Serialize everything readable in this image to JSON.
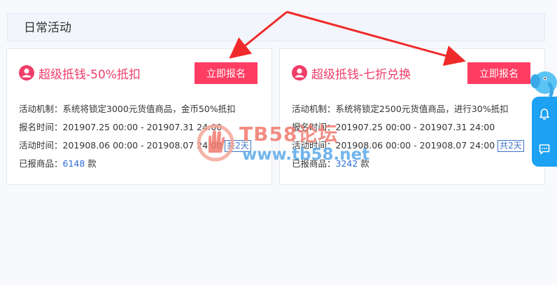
{
  "section": {
    "title": "日常活动"
  },
  "cards": [
    {
      "title": "超级抵钱-50%抵扣",
      "button": "立即报名",
      "mechanism_label": "活动机制：",
      "mechanism": "系统将锁定3000元货值商品，金币50%抵扣",
      "signup_label": "报名时间：",
      "signup_time": "201907.25 00:00 - 201907.31 24:00",
      "activity_label": "活动时间：",
      "activity_time": "201908.06 00:00 - 201908.07 24:00",
      "duration": "共2天",
      "reported_label": "已报商品：",
      "reported_count": "6148",
      "reported_unit": " 款"
    },
    {
      "title": "超级抵钱-七折兑换",
      "button": "立即报名",
      "mechanism_label": "活动机制：",
      "mechanism": "系统将锁定2500元货值商品，进行30%抵扣",
      "signup_label": "报名时间：",
      "signup_time": "201907.25 00:00 - 201907.31 24:00",
      "activity_label": "活动时间：",
      "activity_time": "201908.06 00:00 - 201908.07 24:00",
      "duration": "共2天",
      "reported_label": "已报商品：",
      "reported_count": "3242",
      "reported_unit": " 款"
    }
  ],
  "watermark": {
    "title": "TB58论坛",
    "url": "www.tb58.net"
  },
  "colors": {
    "accent": "#ff3d63",
    "title": "#f03d6a",
    "link": "#2d6bd8",
    "side": "#1da1f2"
  },
  "icons": [
    "user-icon",
    "bell-icon",
    "chat-icon",
    "elephant-mascot-icon"
  ]
}
